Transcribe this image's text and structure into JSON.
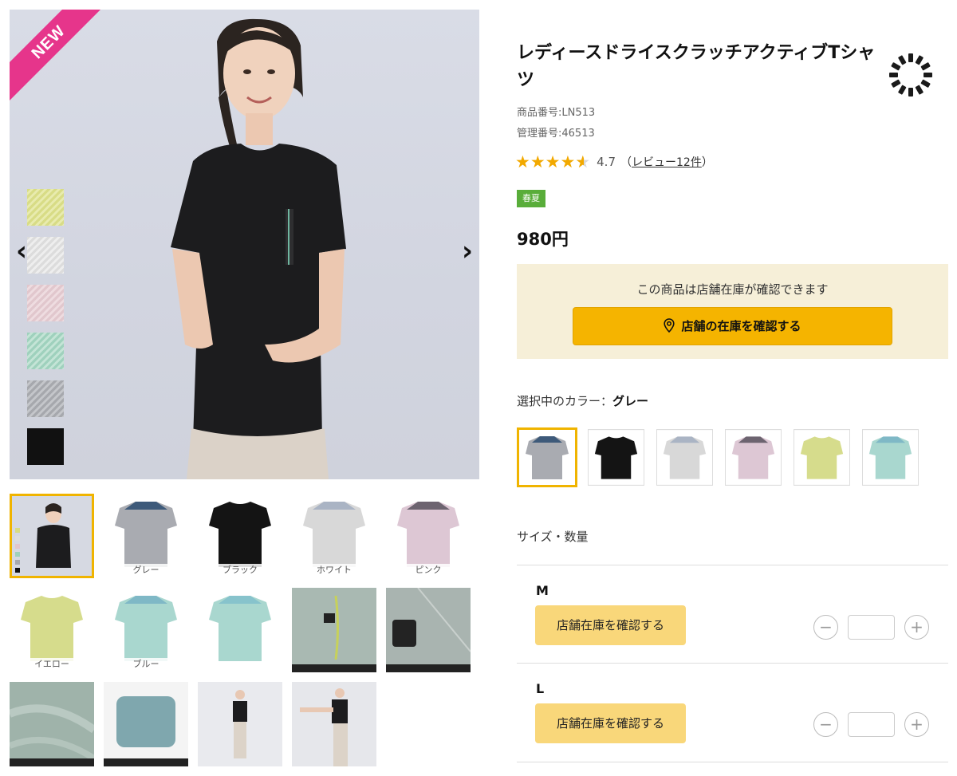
{
  "gallery": {
    "new_badge": "NEW",
    "prev_arrow": "‹",
    "next_arrow": "›",
    "thumb_captions": [
      "グレー",
      "ブラック",
      "ホワイト",
      "ピンク",
      "イエロー",
      "ブルー"
    ]
  },
  "product": {
    "title": "レディースドライスクラッチアクティブTシャツ",
    "product_no": "商品番号:LN513",
    "management_no": "管理番号:46513",
    "rating": "4.7",
    "stars_full": 4,
    "reviews_prefix": "（",
    "reviews_link": "レビュー12件",
    "reviews_suffix": "）",
    "season_tag": "春夏",
    "price": "980円"
  },
  "stock": {
    "message": "この商品は店舗在庫が確認できます",
    "button_label": "店舗の在庫を確認する"
  },
  "color": {
    "label_prefix": "選択中のカラー：",
    "selected": "グレー",
    "options": [
      "グレー",
      "ブラック",
      "ホワイト",
      "ピンク",
      "イエロー",
      "ブルー"
    ]
  },
  "size": {
    "heading": "サイズ・数量",
    "rows": [
      {
        "name": "M",
        "button_label": "店舗在庫を確認する",
        "minus": "−",
        "plus": "+"
      },
      {
        "name": "L",
        "button_label": "店舗在庫を確認する",
        "minus": "−",
        "plus": "+"
      }
    ]
  },
  "colors": {
    "accent": "#f5b400",
    "accent_light": "#f9d77a",
    "stock_bg": "#f6efd8",
    "new_ribbon": "#e6358b",
    "season_green": "#59ad3a",
    "star": "#f2a900"
  }
}
